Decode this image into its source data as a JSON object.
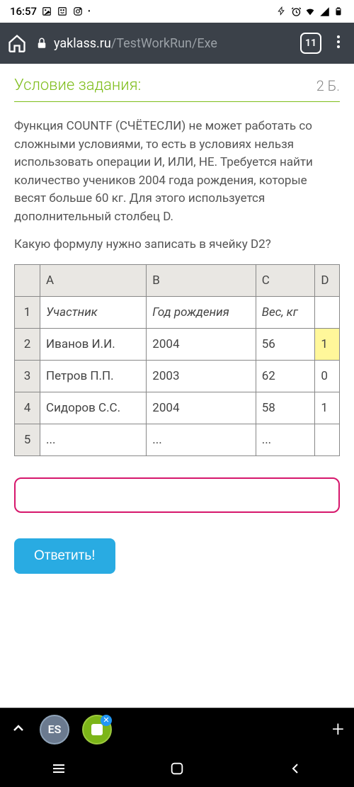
{
  "status": {
    "time": "16:57",
    "icons_left": [
      "image-icon",
      "smile-icon",
      "instagram-icon",
      "dot-icon"
    ],
    "icons_right": [
      "battery-save-icon",
      "alarm-icon",
      "wifi-icon",
      "signal-icon",
      "battery-icon"
    ]
  },
  "browser": {
    "domain": "yaklass.ru",
    "path": "/TestWorkRun/Exe",
    "tab_count": "11"
  },
  "task": {
    "title": "Условие задания:",
    "points": "2 Б.",
    "body": "Функция COUNTF (СЧЁТЕСЛИ) не может работать со сложными условиями, то есть в условиях нельзя использовать операции И, ИЛИ, НЕ. Требуется найти количество учеников 2004 года рождения, которые весят больше 60 кг. Для этого используется дополнительный столбец D.",
    "question": "Какую формулу нужно записать в ячейку D2?",
    "submit_label": "Ответить!"
  },
  "table": {
    "cols": [
      "A",
      "B",
      "C",
      "D"
    ],
    "rows": [
      {
        "num": "1",
        "a": "Участник",
        "b": "Год рождения",
        "c": "Вес, кг",
        "d": "",
        "italic": true
      },
      {
        "num": "2",
        "a": "Иванов И.И.",
        "b": "2004",
        "c": "56",
        "d": "1",
        "highlight_d": true
      },
      {
        "num": "3",
        "a": "Петров П.П.",
        "b": "2003",
        "c": "62",
        "d": "0"
      },
      {
        "num": "4",
        "a": "Сидоров С.С.",
        "b": "2004",
        "c": "58",
        "d": "1"
      },
      {
        "num": "5",
        "a": "...",
        "b": "...",
        "c": "...",
        "d": ""
      }
    ]
  },
  "app_bar": {
    "es_label": "ES"
  }
}
